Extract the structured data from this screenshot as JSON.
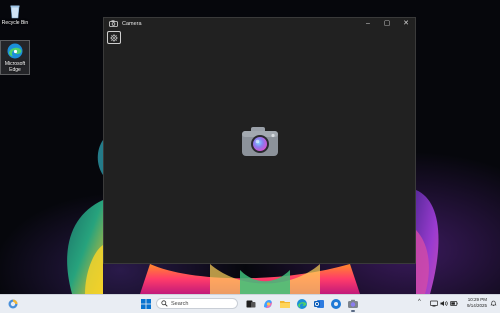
{
  "desktop": {
    "icons": [
      {
        "label": "Recycle Bin",
        "icon": "recycle-bin-icon"
      },
      {
        "label": "Microsoft Edge",
        "icon": "edge-icon"
      }
    ]
  },
  "window": {
    "title": "Camera",
    "app_icon": "camera-icon",
    "controls": {
      "minimize": "–",
      "maximize": "▢",
      "close": "✕"
    },
    "settings_icon": "gear-icon",
    "center_icon": "camera-app-icon"
  },
  "taskbar": {
    "search_label": "Search",
    "pinned_icons": [
      "windows-start-icon",
      "task-view-icon",
      "copilot-icon",
      "edge-icon",
      "file-explorer-icon",
      "outlook-icon",
      "edge-dev-icon",
      "store-icon",
      "photos-icon",
      "camera-icon"
    ],
    "tray_icons": [
      "network-icon",
      "volume-icon",
      "battery-icon"
    ],
    "time": "10:29 PM",
    "date": "9/14/2025"
  },
  "colors": {
    "window_bg": "#212121",
    "taskbar_bg": "#e9edf3",
    "accent": "#0078d4"
  }
}
